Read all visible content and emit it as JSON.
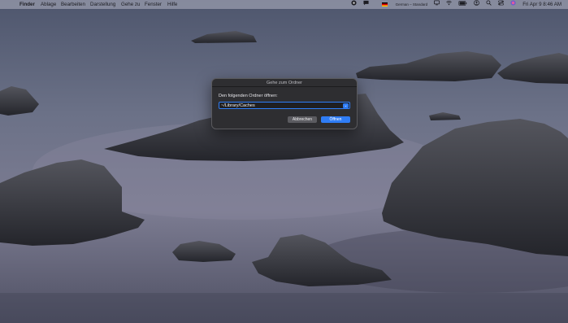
{
  "menubar": {
    "app": "Finder",
    "menus": [
      "Ablage",
      "Bearbeiten",
      "Darstellung",
      "Gehe zu",
      "Fenster",
      "Hilfe"
    ],
    "keyboard_layout": "German – Standard",
    "datetime": "Fri Apr 9  8:46 AM"
  },
  "dialog": {
    "title": "Gehe zum Ordner",
    "prompt": "Den folgenden Ordner öffnen:",
    "path_value": "~/Library/Caches",
    "cancel_label": "Abbrechen",
    "open_label": "Öffnen"
  },
  "colors": {
    "accent": "#2f7df6",
    "dialog_bg": "#2e2e31"
  }
}
